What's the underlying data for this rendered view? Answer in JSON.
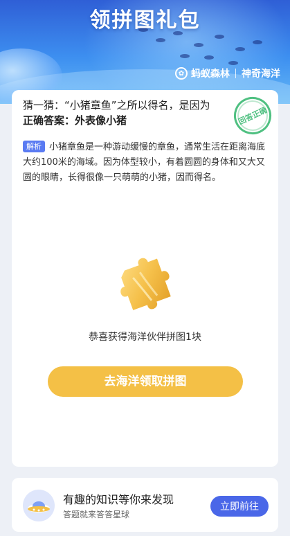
{
  "banner": {
    "title": "领拼图礼包",
    "brand_left": "蚂蚁森林",
    "brand_right": "神奇海洋"
  },
  "quiz": {
    "question": "猜一猜：“小猪章鱼”之所以得名，是因为",
    "answer": "正确答案：外表像小猪",
    "stamp": "回答正确",
    "analysis_tag": "解析",
    "analysis": "小猪章鱼是一种游动缓慢的章鱼，通常生活在距离海底大约100米的海域。因为体型较小，有着圆圆的身体和又大又圆的眼睛，长得很像一只萌萌的小猪，因而得名。"
  },
  "reward": {
    "text": "恭喜获得海洋伙伴拼图1块",
    "cta_label": "去海洋领取拼图"
  },
  "promo": {
    "title": "有趣的知识等你来发现",
    "subtitle": "答题就来答答星球",
    "button_label": "立即前往"
  },
  "colors": {
    "accent": "#4a67e8",
    "cta": "#f4c046",
    "stamp": "#4fc081"
  }
}
